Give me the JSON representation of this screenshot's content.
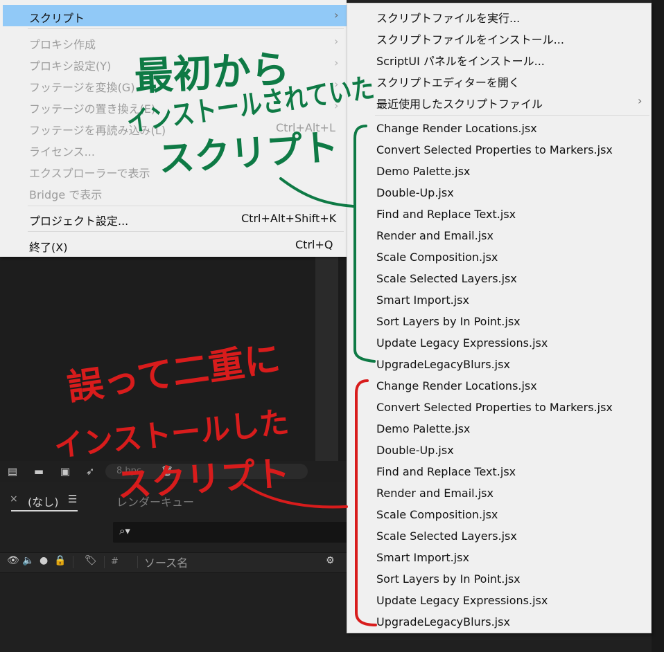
{
  "menu": {
    "highlighted": {
      "label": "スクリプト"
    },
    "items": [
      {
        "label": "プロキシ作成"
      },
      {
        "label": "プロキシ設定(Y)"
      },
      {
        "label": "フッテージを変換(G)"
      },
      {
        "label": "フッテージの置き換え(E)"
      },
      {
        "label": "フッテージを再読み込み(L)",
        "shortcut": "Ctrl+Alt+L"
      },
      {
        "label": "ライセンス..."
      },
      {
        "label": "エクスプローラーで表示"
      },
      {
        "label": "Bridge で表示"
      },
      {
        "label": "プロジェクト設定...",
        "shortcut": "Ctrl+Alt+Shift+K"
      },
      {
        "label": "終了(X)",
        "shortcut": "Ctrl+Q"
      }
    ]
  },
  "submenu": {
    "commands": [
      {
        "label": "スクリプトファイルを実行..."
      },
      {
        "label": "スクリプトファイルをインストール..."
      },
      {
        "label": "ScriptUI パネルをインストール..."
      },
      {
        "label": "スクリプトエディターを開く"
      },
      {
        "label": "最近使用したスクリプトファイル"
      }
    ],
    "scripts": [
      "Change Render Locations.jsx",
      "Convert Selected Properties to Markers.jsx",
      "Demo Palette.jsx",
      "Double-Up.jsx",
      "Find and Replace Text.jsx",
      "Render and Email.jsx",
      "Scale Composition.jsx",
      "Scale Selected Layers.jsx",
      "Smart Import.jsx",
      "Sort Layers by In Point.jsx",
      "Update Legacy Expressions.jsx",
      "UpgradeLegacyBlurs.jsx",
      "Change Render Locations.jsx",
      "Convert Selected Properties to Markers.jsx",
      "Demo Palette.jsx",
      "Double-Up.jsx",
      "Find and Replace Text.jsx",
      "Render and Email.jsx",
      "Scale Composition.jsx",
      "Scale Selected Layers.jsx",
      "Smart Import.jsx",
      "Sort Layers by In Point.jsx",
      "Update Legacy Expressions.jsx",
      "UpgradeLegacyBlurs.jsx"
    ]
  },
  "bottom": {
    "tab_close": "×",
    "tab_none": "(なし)",
    "tab_menu": "☰",
    "tab_render_queue": "レンダーキュー",
    "bpc": "8 bpc",
    "column_hash": "#",
    "column_source_name": "ソース名"
  },
  "annotations": {
    "green": [
      "最初から",
      "インストールされていた",
      "スクリプト"
    ],
    "red": [
      "誤って二重に",
      "インストールした",
      "スクリプト"
    ],
    "green_color": "#0e7a45",
    "red_color": "#d81c1c"
  },
  "colors": {
    "highlight": "#91c9f7",
    "menu_bg": "#f0f0f0",
    "disabled_text": "#9d9d9d"
  }
}
